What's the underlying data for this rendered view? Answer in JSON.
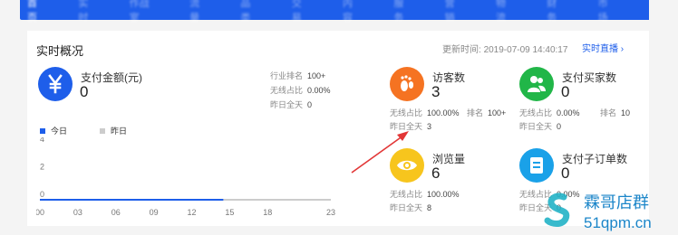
{
  "nav": {
    "items": [
      "首页",
      "实时",
      "作战室",
      "流量",
      "品类",
      "交易",
      "内容",
      "服务",
      "营销",
      "物流",
      "财务",
      "市场"
    ]
  },
  "card": {
    "title": "实时概况",
    "update_label": "更新时间:",
    "update_time": "2019-07-09 14:40:17",
    "live_link": "实时直播 ›"
  },
  "pay": {
    "icon": "yen-icon",
    "label": "支付金额(元)",
    "value": "0",
    "stats": [
      {
        "key": "行业排名",
        "val": "100+"
      },
      {
        "key": "无线占比",
        "val": "0.00%"
      },
      {
        "key": "昨日全天",
        "val": "0"
      }
    ]
  },
  "legend": {
    "today": "今日",
    "yesterday": "昨日"
  },
  "chart_data": {
    "type": "line",
    "x_ticks": [
      "00",
      "03",
      "06",
      "09",
      "12",
      "15",
      "18",
      "23"
    ],
    "y_ticks": [
      "0",
      "2",
      "4"
    ],
    "ylim": [
      0,
      4
    ],
    "series": [
      {
        "name": "今日",
        "color": "#1e5eea",
        "x": [
          0,
          14.5
        ],
        "y": [
          0,
          0
        ]
      },
      {
        "name": "昨日",
        "color": "#cccccc",
        "x": [
          0,
          23
        ],
        "y": [
          0,
          0
        ]
      }
    ]
  },
  "metrics": {
    "visitors": {
      "icon": "footprint-icon",
      "label": "访客数",
      "value": "3",
      "stats": [
        {
          "key": "无线占比",
          "val": "100.00%"
        },
        {
          "key": "排名",
          "val": "100+"
        },
        {
          "key": "昨日全天",
          "val": "3"
        }
      ]
    },
    "buyers": {
      "icon": "users-icon",
      "label": "支付买家数",
      "value": "0",
      "stats": [
        {
          "key": "无线占比",
          "val": "0.00%"
        },
        {
          "key": "排名",
          "val": "10"
        },
        {
          "key": "昨日全天",
          "val": "0"
        }
      ]
    },
    "pageviews": {
      "icon": "eye-icon",
      "label": "浏览量",
      "value": "6",
      "stats": [
        {
          "key": "无线占比",
          "val": "100.00%"
        },
        {
          "key": "昨日全天",
          "val": "8"
        }
      ]
    },
    "suborders": {
      "icon": "document-icon",
      "label": "支付子订单数",
      "value": "0",
      "stats": [
        {
          "key": "无线占比",
          "val": "0.00%"
        },
        {
          "key": "昨日全天",
          "val": "0"
        }
      ]
    }
  },
  "watermark": {
    "title": "霖哥店群",
    "site": "51qpm.cn"
  },
  "colors": {
    "nav": "#1e5eea",
    "pay": "#1e5eea",
    "visitors": "#f57322",
    "buyers": "#21b648",
    "pageviews": "#f7c51d",
    "suborders": "#1aa1e8",
    "arrow": "#e23636"
  }
}
